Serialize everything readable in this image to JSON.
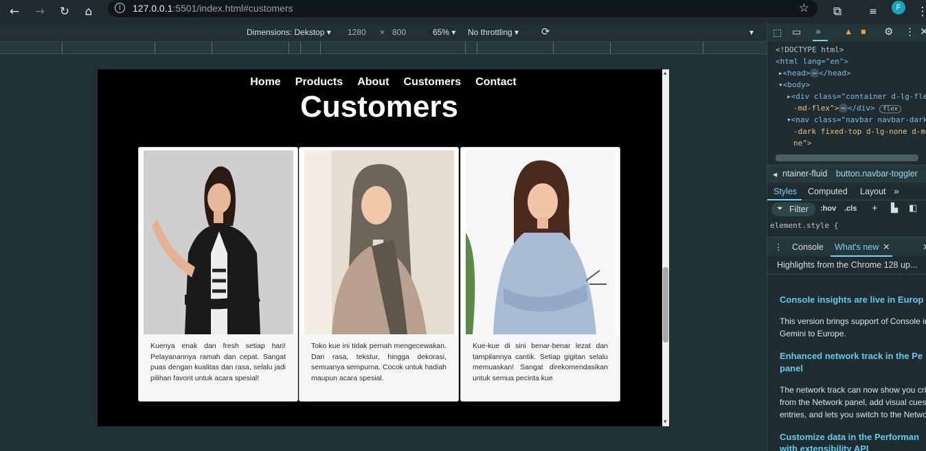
{
  "browser": {
    "url_host": "127.0.0.1",
    "url_rest": ":5501/index.html#customers",
    "profile_initial": "F"
  },
  "device_toolbar": {
    "dimensions_label": "Dimensions: Dekstop",
    "width": "1280",
    "times": "×",
    "height": "800",
    "zoom": "65%",
    "throttling": "No throttling"
  },
  "site": {
    "nav": [
      "Home",
      "Products",
      "About",
      "Customers",
      "Contact"
    ],
    "heading": "Customers",
    "cards": [
      {
        "text": "Kuenya enak dan fresh setiap hari! Pelayanannya ramah dan cepat. Sangat puas dengan kualitas dan rasa, selalu jadi pilihan favorit untuk acara spesial!"
      },
      {
        "text": "Toko kue ini tidak pernah mengecewakan. Dari rasa, tekstur, hingga dekorasi, semuanya sempurna. Cocok untuk hadiah maupun acara spesial."
      },
      {
        "text": "Kue-kue di sini benar-benar lezat dan tampilannya cantik. Setiap gigitan selalu memuaskan! Sangat direkomendasikan untuk semua pecinta kue"
      }
    ]
  },
  "devtools": {
    "elements": [
      "<!DOCTYPE html>",
      "<html lang=\"en\">",
      "<head>",
      "</head>",
      "<body>",
      "<div class=\"container d-lg-fle",
      "-md-flex\">",
      "</div>",
      "flex",
      "<nav class=\"navbar navbar-dark",
      "-dark fixed-top d-lg-none d-md",
      "ne\">"
    ],
    "breadcrumbs": [
      "ntainer-fluid",
      "button.navbar-toggler"
    ],
    "style_tabs": [
      "Styles",
      "Computed",
      "Layout"
    ],
    "filter_label": "Filter",
    "hov": ":hov",
    "cls": ".cls",
    "element_style": "element.style {",
    "drawer_tabs": [
      "Console",
      "What's new"
    ],
    "highlights": "Highlights from the Chrome 128 up...",
    "whats_new": [
      {
        "title": "Console insights are live in Europ",
        "body": [
          "This version brings support of Console in",
          "Gemini to Europe."
        ]
      },
      {
        "title": "Enhanced network track in the Pe",
        "title2": "panel",
        "body": [
          "The network track can now show you crit",
          "from the Network panel, add visual cues",
          "entries, and lets you switch to the Netwo"
        ]
      },
      {
        "title": "Customize data in the Performan",
        "title2": "with extensibility API",
        "body": []
      }
    ]
  }
}
